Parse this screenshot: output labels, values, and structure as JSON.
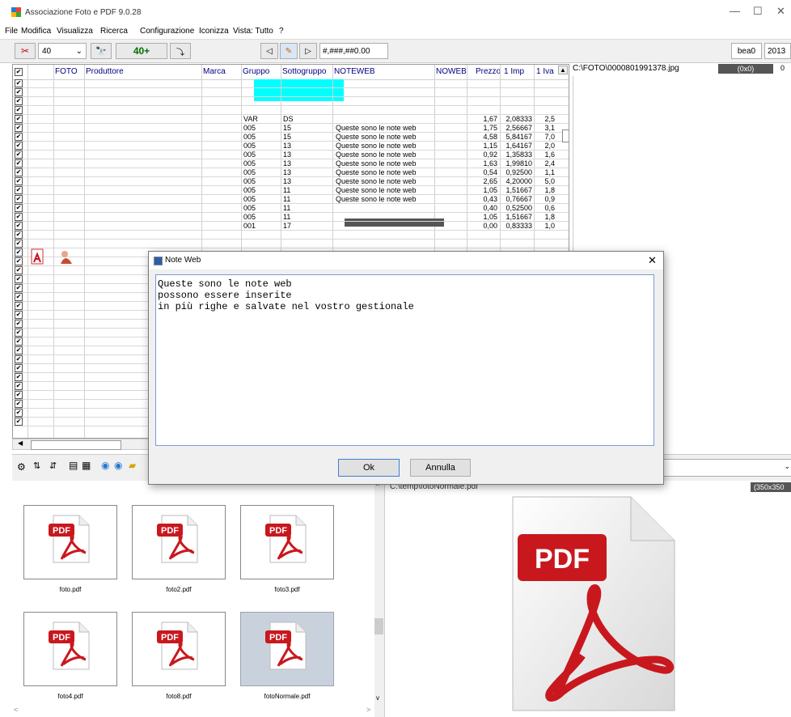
{
  "app": {
    "title": "Associazione Foto e PDF 9.0.28",
    "minimize_glyph": "—",
    "maximize_glyph": "☐",
    "close_glyph": "✕"
  },
  "menu": [
    "File",
    "Modifica",
    "Visualizza",
    "Ricerca",
    "Configurazione",
    "Iconizza",
    "Vista: Tutto",
    "?"
  ],
  "toolbar": {
    "count_value": "40",
    "count_dropdown": "⌄",
    "batch_label": "40+",
    "format_placeholder": "#,###,##0.00",
    "user_field": "bea0",
    "year_field": "2013"
  },
  "grid": {
    "columns": [
      "FOTO",
      "Produttore",
      "Marca",
      "Gruppo",
      "Sottogruppo",
      "NOTEWEB",
      "NOWEB",
      "Prezzo",
      "1 Imp",
      "1 Iva"
    ],
    "rows": [
      {
        "gruppo": "VAR",
        "sottogruppo": "DS",
        "noteweb": "",
        "prezzo": "1,67",
        "imp": "2,08333",
        "iva": "2,5"
      },
      {
        "gruppo": "005",
        "sottogruppo": "15",
        "noteweb": "Queste sono le note web",
        "prezzo": "1,75",
        "imp": "2,56667",
        "iva": "3,1"
      },
      {
        "gruppo": "005",
        "sottogruppo": "15",
        "noteweb": "Queste sono le note web",
        "prezzo": "4,58",
        "imp": "5,84167",
        "iva": "7,0"
      },
      {
        "gruppo": "005",
        "sottogruppo": "13",
        "noteweb": "Queste sono le note web",
        "prezzo": "1,15",
        "imp": "1,64167",
        "iva": "2,0"
      },
      {
        "gruppo": "005",
        "sottogruppo": "13",
        "noteweb": "Queste sono le note web",
        "prezzo": "0,92",
        "imp": "1,35833",
        "iva": "1,6"
      },
      {
        "gruppo": "005",
        "sottogruppo": "13",
        "noteweb": "Queste sono le note web",
        "prezzo": "1,63",
        "imp": "1,99810",
        "iva": "2,4"
      },
      {
        "gruppo": "005",
        "sottogruppo": "13",
        "noteweb": "Queste sono le note web",
        "prezzo": "0,54",
        "imp": "0,92500",
        "iva": "1,1"
      },
      {
        "gruppo": "005",
        "sottogruppo": "13",
        "noteweb": "Queste sono le note web",
        "prezzo": "2,65",
        "imp": "4,20000",
        "iva": "5,0"
      },
      {
        "gruppo": "005",
        "sottogruppo": "11",
        "noteweb": "Queste sono le note web",
        "prezzo": "1,05",
        "imp": "1,51667",
        "iva": "1,8"
      },
      {
        "gruppo": "005",
        "sottogruppo": "11",
        "noteweb": "Queste sono le note web",
        "prezzo": "0,43",
        "imp": "0,76667",
        "iva": "0,9"
      },
      {
        "gruppo": "005",
        "sottogruppo": "11",
        "noteweb": "Queste sono le note web",
        "prezzo": "0,40",
        "imp": "0,52500",
        "iva": "0,6"
      },
      {
        "gruppo": "005",
        "sottogruppo": "11",
        "noteweb": "",
        "prezzo": "1,05",
        "imp": "1,51667",
        "iva": "1,8"
      },
      {
        "gruppo": "001",
        "sottogruppo": "17",
        "noteweb": "",
        "prezzo": "0,00",
        "imp": "0,83333",
        "iva": "1,0"
      }
    ]
  },
  "image_panel": {
    "path": "C:\\FOTO\\0000801991378.jpg",
    "size": "(0x0)",
    "zero": "0"
  },
  "preview": {
    "path": "C:\\temp\\fotoNormale.pdf",
    "size": "(350x350"
  },
  "thumbnails": [
    {
      "label": "foto.pdf"
    },
    {
      "label": "foto2.pdf"
    },
    {
      "label": "foto3.pdf"
    },
    {
      "label": "foto4.pdf"
    },
    {
      "label": "foto8.pdf"
    },
    {
      "label": "fotoNormale.pdf"
    }
  ],
  "pdf_badge": "PDF",
  "dialog": {
    "title": "Note Web",
    "close_glyph": "✕",
    "lines": [
      "Queste sono le note web",
      "possono essere inserite",
      "in più righe e salvate nel vostro gestionale"
    ],
    "ok_label": "Ok",
    "cancel_label": "Annulla"
  },
  "colors": {
    "cyan": "#00ffff",
    "pdf_red": "#c8181e",
    "header_text": "#000080"
  }
}
